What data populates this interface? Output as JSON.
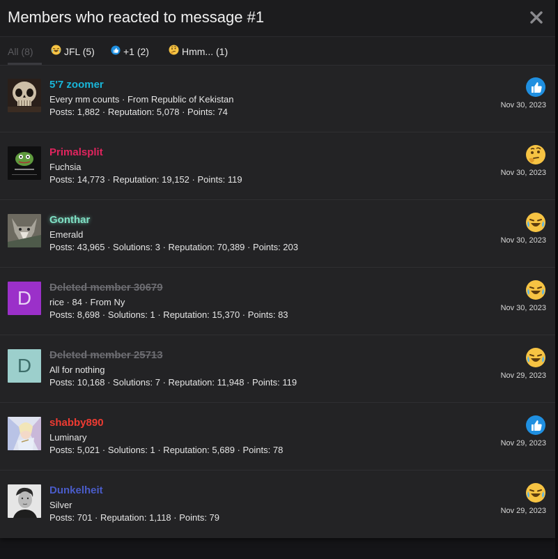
{
  "dialog": {
    "title": "Members who reacted to message #1",
    "close_icon": "close-icon"
  },
  "tabs": [
    {
      "label": "All (8)",
      "icon": ""
    },
    {
      "label": "JFL (5)",
      "icon": "laugh-cry-icon"
    },
    {
      "label": "+1 (2)",
      "icon": "thumbs-up-icon"
    },
    {
      "label": "Hmm... (1)",
      "icon": "thinking-face-icon"
    }
  ],
  "colors": {
    "background": "#232325",
    "header": "#1c1c1e",
    "like_blue": "#1f8fe0"
  },
  "members": [
    {
      "name": "5'7 zoomer",
      "name_color": "#19b6d9",
      "deleted": false,
      "title": "Every mm counts · From Republic of Kekistan",
      "stats": "Posts: 1,882 · Reputation: 5,078 · Points: 74",
      "reaction": "thumbs-up-icon",
      "date": "Nov 30, 2023",
      "avatar": "skull-avatar"
    },
    {
      "name": "Primalsplit",
      "name_color": "#e0245e",
      "deleted": false,
      "title": "Fuchsia",
      "stats": "Posts: 14,773 · Reputation: 19,152 · Points: 119",
      "reaction": "thinking-face-icon",
      "date": "Nov 30, 2023",
      "avatar": "frog-avatar"
    },
    {
      "name": "Gonthar",
      "name_color": "#7fe0c4",
      "deleted": false,
      "title": "Emerald",
      "stats": "Posts: 43,965 · Solutions: 3 · Reputation: 70,389 · Points: 203",
      "reaction": "laugh-cry-icon",
      "date": "Nov 30, 2023",
      "avatar": "wolf-avatar"
    },
    {
      "name": "Deleted member 30679",
      "name_color": "#6d6d72",
      "deleted": true,
      "title": "rice · 84 · From Ny",
      "stats": "Posts: 8,698 · Solutions: 1 · Reputation: 15,370 · Points: 83",
      "reaction": "laugh-cry-icon",
      "date": "Nov 30, 2023",
      "avatar": "letter-avatar",
      "letter": "D",
      "avatar_bg": "#9b30c9",
      "avatar_fg": "#e9d4f5"
    },
    {
      "name": "Deleted member 25713",
      "name_color": "#6d6d72",
      "deleted": true,
      "title": "All for nothing",
      "stats": "Posts: 10,168 · Solutions: 7 · Reputation: 11,948 · Points: 119",
      "reaction": "laugh-cry-icon",
      "date": "Nov 29, 2023",
      "avatar": "letter-avatar",
      "letter": "D",
      "avatar_bg": "#9ccfcc",
      "avatar_fg": "#3d6d6a"
    },
    {
      "name": "shabby890",
      "name_color": "#ef3b32",
      "deleted": false,
      "title": "Luminary",
      "stats": "Posts: 5,021 · Solutions: 1 · Reputation: 5,689 · Points: 78",
      "reaction": "thumbs-up-icon",
      "date": "Nov 29, 2023",
      "avatar": "anime-avatar"
    },
    {
      "name": "Dunkelheit",
      "name_color": "#4a5cc9",
      "deleted": false,
      "title": "Silver",
      "stats": "Posts: 701 · Reputation: 1,118 · Points: 79",
      "reaction": "laugh-cry-icon",
      "date": "Nov 29, 2023",
      "avatar": "portrait-avatar"
    }
  ]
}
